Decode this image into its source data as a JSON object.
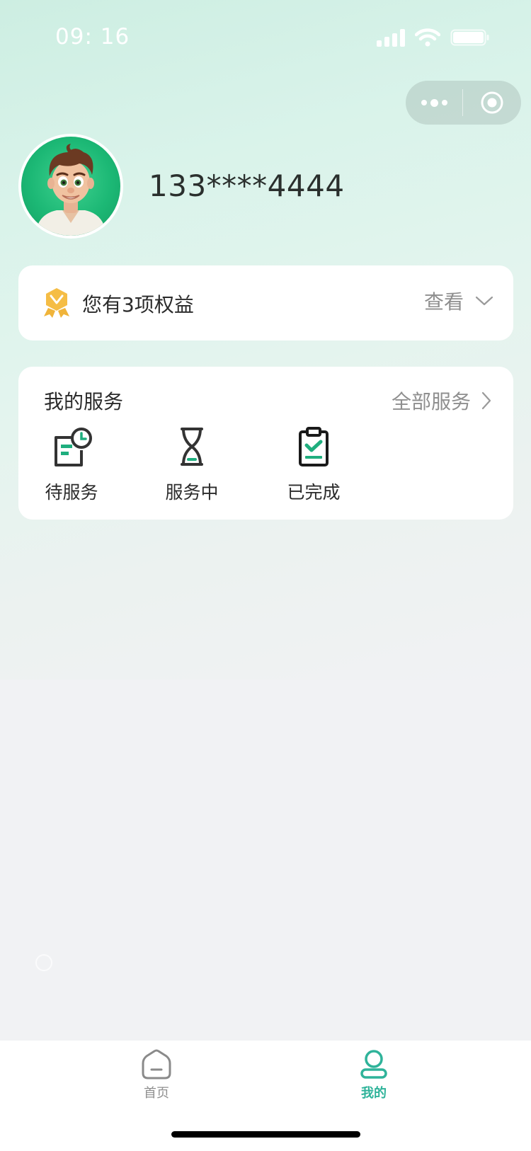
{
  "status_bar": {
    "time": "09: 16"
  },
  "profile": {
    "phone": "133****4444"
  },
  "benefits": {
    "text": "您有3项权益",
    "view_label": "查看"
  },
  "services": {
    "title": "我的服务",
    "all_label": "全部服务",
    "items": [
      {
        "label": "待服务",
        "icon": "pending-service-icon"
      },
      {
        "label": "服务中",
        "icon": "hourglass-icon"
      },
      {
        "label": "已完成",
        "icon": "clipboard-check-icon"
      }
    ]
  },
  "tabbar": {
    "items": [
      {
        "label": "首页",
        "icon": "home-icon",
        "active": false
      },
      {
        "label": "我的",
        "icon": "user-icon",
        "active": true
      }
    ]
  },
  "colors": {
    "accent": "#2fb39a",
    "service_green": "#1fae7e",
    "benefit_gold": "#f0b43a",
    "text_primary": "#2b2b2b",
    "text_secondary": "#8f8f8f"
  }
}
